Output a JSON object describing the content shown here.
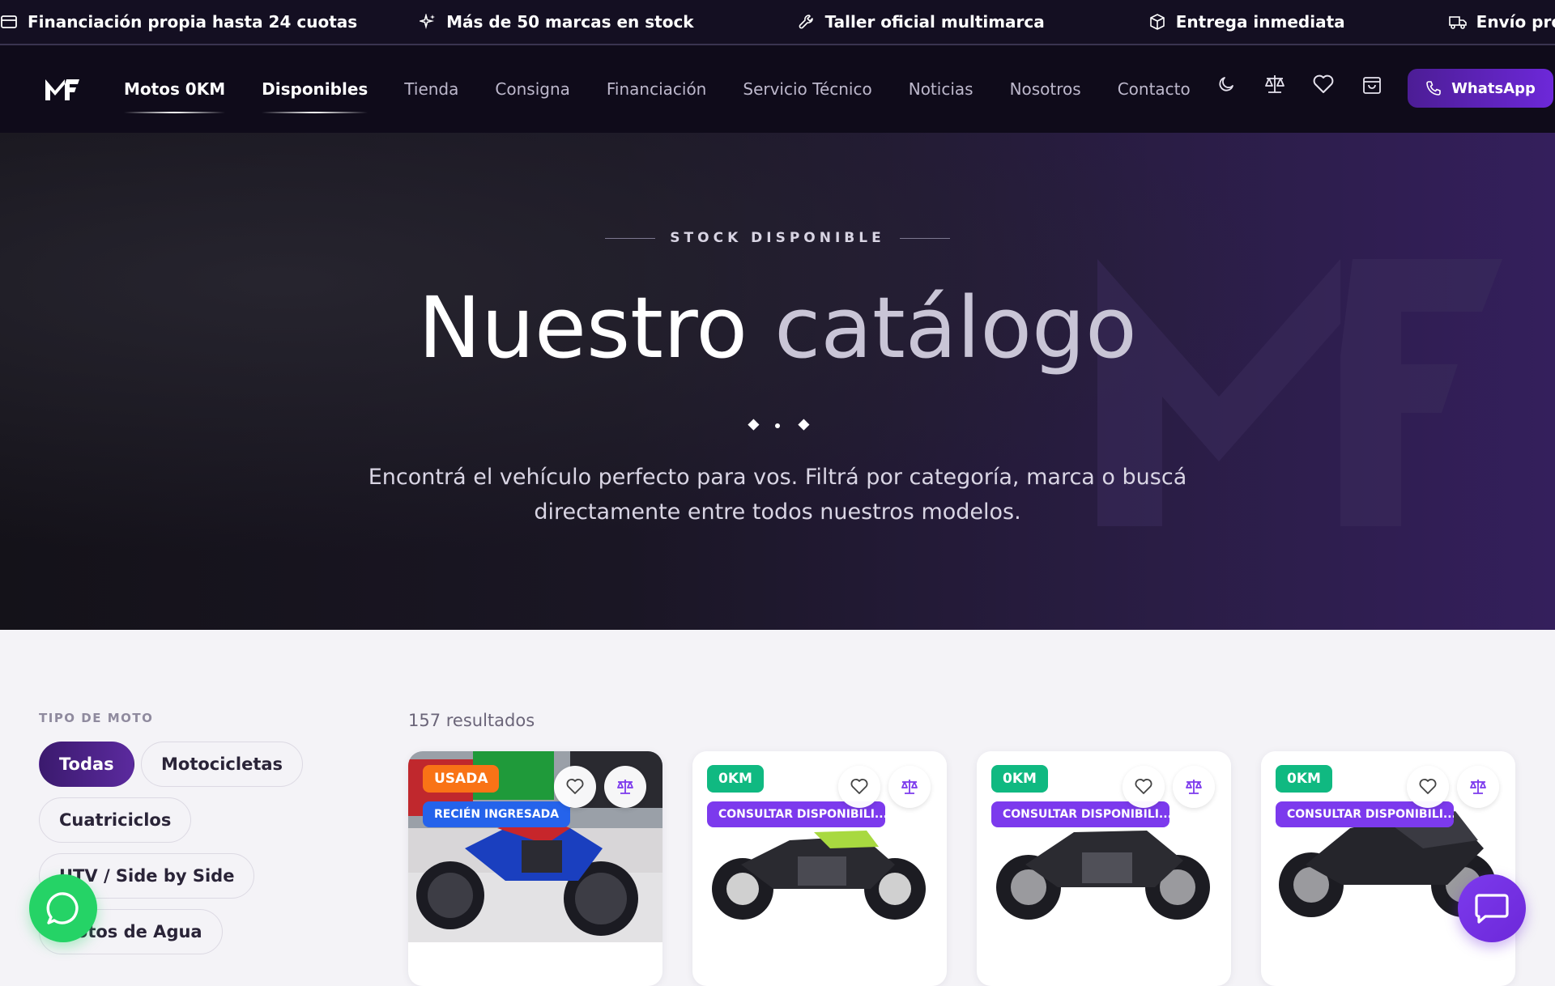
{
  "topbar": {
    "items": [
      {
        "label": "Financiación propia hasta 24 cuotas",
        "icon": "credit-card-icon"
      },
      {
        "label": "Más de 50 marcas en stock",
        "icon": "sparkles-icon"
      },
      {
        "label": "Taller oficial multimarca",
        "icon": "wrench-icon"
      },
      {
        "label": "Entrega inmediata",
        "icon": "box-icon"
      },
      {
        "label": "Envío prop",
        "icon": "truck-icon"
      }
    ]
  },
  "nav": {
    "links": [
      "Motos 0KM",
      "Disponibles",
      "Tienda",
      "Consigna",
      "Financiación",
      "Servicio Técnico",
      "Noticias",
      "Nosotros",
      "Contacto"
    ],
    "whatsapp_label": "WhatsApp",
    "icons": [
      "moon-icon",
      "scale-icon",
      "heart-icon",
      "bag-icon"
    ]
  },
  "hero": {
    "eyebrow": "STOCK DISPONIBLE",
    "title_main": "Nuestro",
    "title_light": "catálogo",
    "subtitle": "Encontrá el vehículo perfecto para vos. Filtrá por categoría, marca o buscá directamente entre todos nuestros modelos."
  },
  "filters": {
    "label": "TIPO DE MOTO",
    "chips": [
      "Todas",
      "Motocicletas",
      "Cuatriciclos",
      "UTV / Side by Side",
      "Motos de Agua"
    ],
    "selected": "Todas"
  },
  "results": {
    "count_label": "157 resultados"
  },
  "cards": [
    {
      "condition": "USADA",
      "status": "RECIÉN INGRESADA"
    },
    {
      "condition": "0KM",
      "status": "CONSULTAR DISPONIBILI..."
    },
    {
      "condition": "0KM",
      "status": "CONSULTAR DISPONIBILI..."
    },
    {
      "condition": "0KM",
      "status": "CONSULTAR DISPONIBILI..."
    }
  ],
  "colors": {
    "accent": "#6d28d9",
    "used_badge": "#f97316",
    "new_badge": "#10b981",
    "fresh_badge": "#2563eb",
    "consult_badge": "#7c3aed",
    "whatsapp": "#25d366"
  }
}
